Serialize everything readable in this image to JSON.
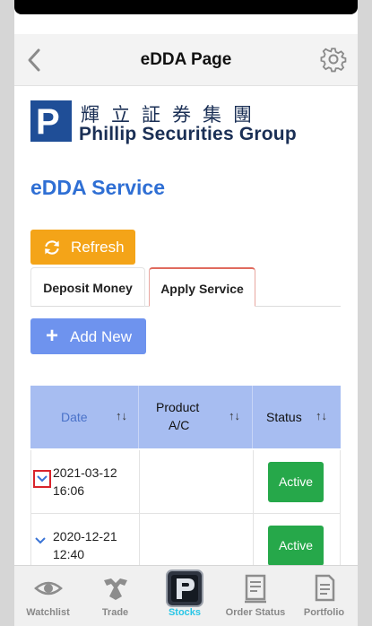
{
  "header": {
    "title": "eDDA Page"
  },
  "logo": {
    "mark": "P",
    "chinese": "輝立証券集團",
    "english": "Phillip Securities Group"
  },
  "section_title": "eDDA Service",
  "buttons": {
    "refresh_label": "Refresh",
    "add_new_label": "Add New"
  },
  "tabs": [
    {
      "label": "Deposit Money",
      "active": false
    },
    {
      "label": "Apply Service",
      "active": true
    }
  ],
  "table": {
    "columns": [
      {
        "label": "Date",
        "sort": "↑↓"
      },
      {
        "label_line1": "Product",
        "label_line2": "A/C",
        "sort": "↑↓"
      },
      {
        "label": "Status",
        "sort": "↑↓"
      }
    ],
    "rows": [
      {
        "date": "2021-03-12",
        "time": "16:06",
        "product_ac": "",
        "status": "Active"
      },
      {
        "date": "2020-12-21",
        "time": "12:40",
        "product_ac": "",
        "status": "Active"
      }
    ]
  },
  "tabbar": [
    {
      "label": "Watchlist",
      "icon": "eye-icon",
      "active": false
    },
    {
      "label": "Trade",
      "icon": "handshake-icon",
      "active": false
    },
    {
      "label": "Stocks",
      "icon": "phillip-logo-icon",
      "active": true
    },
    {
      "label": "Order Status",
      "icon": "order-list-icon",
      "active": false
    },
    {
      "label": "Portfolio",
      "icon": "portfolio-doc-icon",
      "active": false
    }
  ],
  "colors": {
    "accent_blue": "#2f6fd4",
    "refresh_orange": "#f4a418",
    "add_blue": "#6e93ee",
    "header_blue": "#a7bdf1",
    "status_green": "#26a84a",
    "active_tab_cyan": "#29c6e6"
  }
}
